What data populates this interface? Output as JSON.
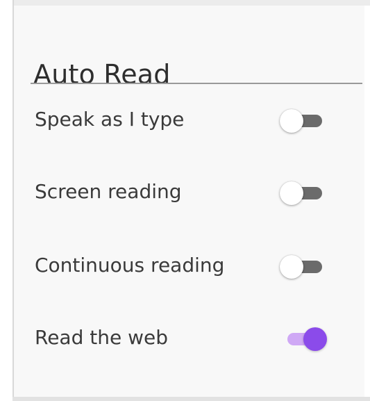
{
  "panel": {
    "title": "Auto Read"
  },
  "settings": [
    {
      "label": "Speak as I type",
      "enabled": false
    },
    {
      "label": "Screen reading",
      "enabled": false
    },
    {
      "label": "Continuous reading",
      "enabled": false
    },
    {
      "label": "Read the web",
      "enabled": true
    }
  ],
  "colors": {
    "accent": "#8b4bea",
    "accent_track": "#cfa8f5",
    "off_track": "#6b6b6b",
    "panel_bg": "#f8f8f8",
    "text": "#3a3a3a"
  }
}
